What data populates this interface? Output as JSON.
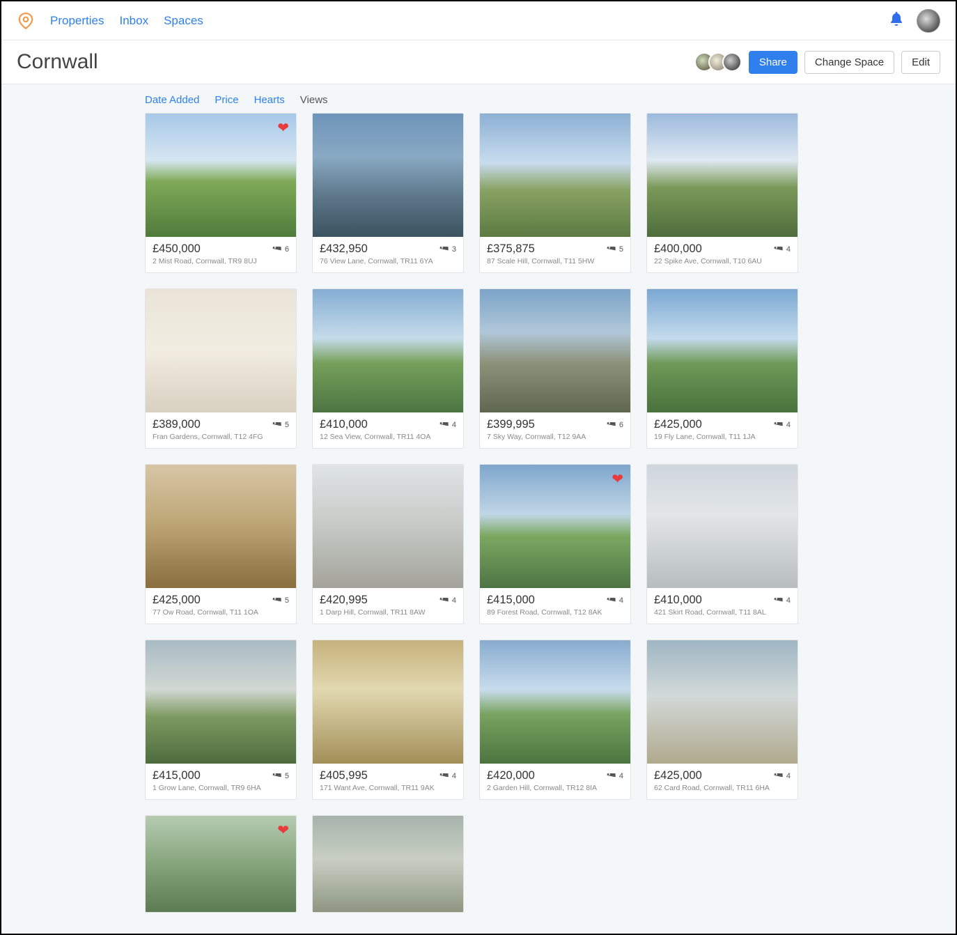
{
  "nav": {
    "links": [
      "Properties",
      "Inbox",
      "Spaces"
    ]
  },
  "header": {
    "title": "Cornwall",
    "share": "Share",
    "changeSpace": "Change Space",
    "edit": "Edit"
  },
  "sort": {
    "items": [
      "Date Added",
      "Price",
      "Hearts",
      "Views"
    ],
    "activeIndex": 3
  },
  "listings": [
    {
      "price": "£450,000",
      "beds": "6",
      "address": "2 Mist Road, Cornwall, TR9 8UJ",
      "hearted": true,
      "g": "g1"
    },
    {
      "price": "£432,950",
      "beds": "3",
      "address": "76 View Lane, Cornwall, TR11 6YA",
      "hearted": false,
      "g": "g2"
    },
    {
      "price": "£375,875",
      "beds": "5",
      "address": "87 Scale Hill, Cornwall, T11 5HW",
      "hearted": false,
      "g": "g3"
    },
    {
      "price": "£400,000",
      "beds": "4",
      "address": "22 Spike Ave, Cornwall, T10 6AU",
      "hearted": false,
      "g": "g4"
    },
    {
      "price": "£389,000",
      "beds": "5",
      "address": "Fran Gardens, Cornwall, T12 4FG",
      "hearted": false,
      "g": "g5"
    },
    {
      "price": "£410,000",
      "beds": "4",
      "address": "12 Sea View, Cornwall, TR11 4OA",
      "hearted": false,
      "g": "g6"
    },
    {
      "price": "£399,995",
      "beds": "6",
      "address": "7 Sky Way, Cornwall, T12 9AA",
      "hearted": false,
      "g": "g7"
    },
    {
      "price": "£425,000",
      "beds": "4",
      "address": "19 Fly Lane, Cornwall, T11 1JA",
      "hearted": false,
      "g": "g8"
    },
    {
      "price": "£425,000",
      "beds": "5",
      "address": "77 Ow Road, Cornwall, T11 1OA",
      "hearted": false,
      "g": "g9"
    },
    {
      "price": "£420,995",
      "beds": "4",
      "address": "1 Darp Hill, Cornwall, TR11 8AW",
      "hearted": false,
      "g": "g10"
    },
    {
      "price": "£415,000",
      "beds": "4",
      "address": "89 Forest Road, Cornwall, T12 8AK",
      "hearted": true,
      "g": "g11"
    },
    {
      "price": "£410,000",
      "beds": "4",
      "address": "421 Skirt Road, Cornwall, T11 8AL",
      "hearted": false,
      "g": "g12"
    },
    {
      "price": "£415,000",
      "beds": "5",
      "address": "1 Grow Lane, Cornwall, TR9 6HA",
      "hearted": false,
      "g": "g13"
    },
    {
      "price": "£405,995",
      "beds": "4",
      "address": "171 Want Ave, Cornwall, TR11 9AK",
      "hearted": false,
      "g": "g14"
    },
    {
      "price": "£420,000",
      "beds": "4",
      "address": "2 Garden Hill, Cornwall, TR12 8IA",
      "hearted": false,
      "g": "g15"
    },
    {
      "price": "£425,000",
      "beds": "4",
      "address": "62 Card Road, Cornwall, TR11 6HA",
      "hearted": false,
      "g": "g16"
    },
    {
      "price": "",
      "beds": "",
      "address": "",
      "hearted": true,
      "g": "g17",
      "partial": true
    },
    {
      "price": "",
      "beds": "",
      "address": "",
      "hearted": false,
      "g": "g18",
      "partial": true
    }
  ]
}
